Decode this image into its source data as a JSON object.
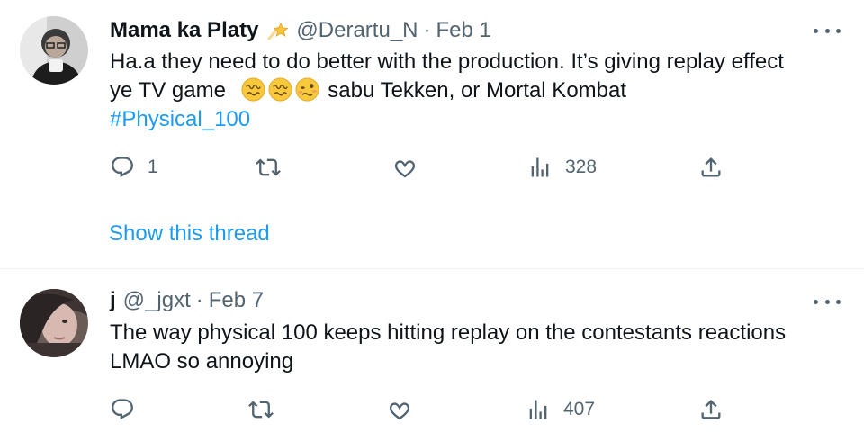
{
  "tweets": [
    {
      "name": "Mama ka Platy",
      "name_badge_icon": "shooting-star-emoji",
      "handle": "@Derartu_N",
      "separator": "·",
      "date": "Feb 1",
      "text_line1": "Ha.a they need to do better with the production. It’s giving replay effect",
      "text_line2_before": "ye TV game",
      "text_line2_emojis": [
        "dizzy-face-emoji",
        "dizzy-face-emoji",
        "woozy-face-emoji"
      ],
      "text_line2_after": "sabu Tekken, or Mortal Kombat",
      "hashtag": "#Physical_100",
      "replies": "1",
      "retweets": "",
      "likes": "",
      "views": "328",
      "show_thread": "Show this thread"
    },
    {
      "name": "j",
      "handle": "@_jgxt",
      "separator": "·",
      "date": "Feb 7",
      "text_line1": "The way physical 100 keeps hitting replay on the contestants reactions",
      "text_line2": "LMAO so annoying",
      "replies": "",
      "retweets": "",
      "likes": "",
      "views": "407"
    }
  ],
  "colors": {
    "text": "#0f1419",
    "secondary": "#536471",
    "link": "#1d9bf0",
    "divider": "#eff3f4"
  }
}
